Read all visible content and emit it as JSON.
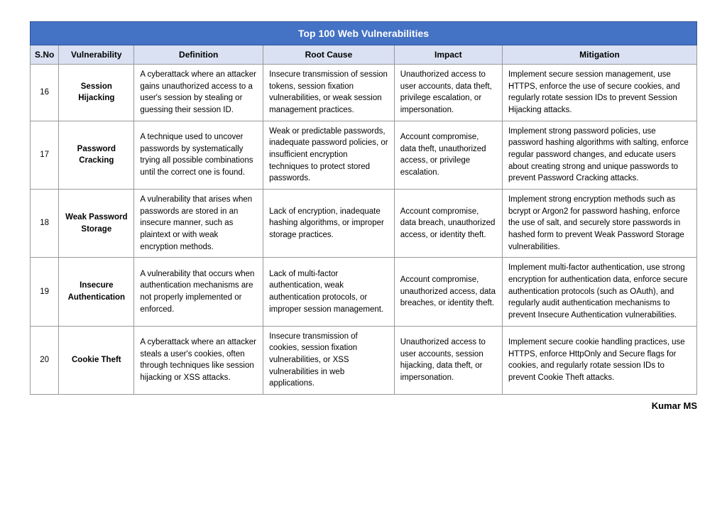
{
  "table": {
    "title": "Top 100  Web Vulnerabilities",
    "headers": [
      "S.No",
      "Vulnerability",
      "Definition",
      "Root Cause",
      "Impact",
      "Mitigation"
    ],
    "rows": [
      {
        "num": "16",
        "vulnerability": "Session Hijacking",
        "definition": "A cyberattack where an attacker gains unauthorized access to a user's session by stealing or guessing their session ID.",
        "root_cause": "Insecure transmission of session tokens, session fixation vulnerabilities, or weak session management practices.",
        "impact": "Unauthorized access to user accounts, data theft, privilege escalation, or impersonation.",
        "mitigation": "Implement secure session management, use HTTPS, enforce the use of secure cookies, and regularly rotate session IDs to prevent Session Hijacking attacks."
      },
      {
        "num": "17",
        "vulnerability": "Password Cracking",
        "definition": "A technique used to uncover passwords by systematically trying all possible combinations until the correct one is found.",
        "root_cause": "Weak or predictable passwords, inadequate password policies, or insufficient encryption techniques to protect stored passwords.",
        "impact": "Account compromise, data theft, unauthorized access, or privilege escalation.",
        "mitigation": "Implement strong password policies, use password hashing algorithms with salting, enforce regular password changes, and educate users about creating strong and unique passwords to prevent Password Cracking attacks."
      },
      {
        "num": "18",
        "vulnerability": "Weak Password Storage",
        "definition": "A vulnerability that arises when passwords are stored in an insecure manner, such as plaintext or with weak encryption methods.",
        "root_cause": "Lack of encryption, inadequate hashing algorithms, or improper storage practices.",
        "impact": "Account compromise, data breach, unauthorized access, or identity theft.",
        "mitigation": "Implement strong encryption methods such as bcrypt or Argon2 for password hashing, enforce the use of salt, and securely store passwords in hashed form to prevent Weak Password Storage vulnerabilities."
      },
      {
        "num": "19",
        "vulnerability": "Insecure Authentication",
        "definition": "A vulnerability that occurs when authentication mechanisms are not properly implemented or enforced.",
        "root_cause": "Lack of multi-factor authentication, weak authentication protocols, or improper session management.",
        "impact": "Account compromise, unauthorized access, data breaches, or identity theft.",
        "mitigation": "Implement multi-factor authentication, use strong encryption for authentication data, enforce secure authentication protocols (such as OAuth), and regularly audit authentication mechanisms to prevent Insecure Authentication vulnerabilities."
      },
      {
        "num": "20",
        "vulnerability": "Cookie Theft",
        "definition": "A cyberattack where an attacker steals a user's cookies, often through techniques like session hijacking or XSS attacks.",
        "root_cause": "Insecure transmission of cookies, session fixation vulnerabilities, or XSS vulnerabilities in web applications.",
        "impact": "Unauthorized access to user accounts, session hijacking, data theft, or impersonation.",
        "mitigation": "Implement secure cookie handling practices, use HTTPS, enforce HttpOnly and Secure flags for cookies, and regularly rotate session IDs to prevent Cookie Theft attacks."
      }
    ],
    "footer": "Kumar MS"
  }
}
